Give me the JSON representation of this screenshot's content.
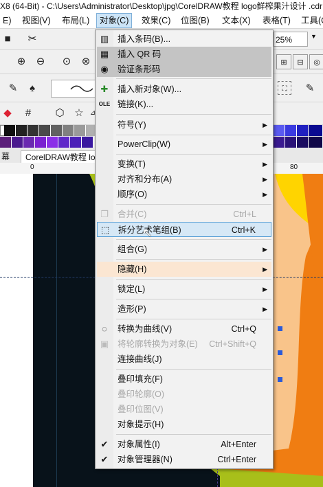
{
  "titlebar": {
    "text": "X8 (64-Bit) - C:\\Users\\Administrator\\Desktop\\jpg\\CorelDRAW教程 logo鲜榨果汁设计 .cdr"
  },
  "menubar": [
    {
      "label": "E)"
    },
    {
      "label": "视图(V)"
    },
    {
      "label": "布局(L)"
    },
    {
      "label": "对象(C)"
    },
    {
      "label": "效果(C)"
    },
    {
      "label": "位图(B)"
    },
    {
      "label": "文本(X)"
    },
    {
      "label": "表格(T)"
    },
    {
      "label": "工具(O"
    }
  ],
  "toolbar": {
    "zoom_value": "25%"
  },
  "tabs": {
    "left_tab": "幕",
    "doc_tab": "CorelDRAW教程 log"
  },
  "ruler": {
    "mark_0": "0",
    "mark_80": "80"
  },
  "menu": {
    "items": [
      {
        "label": "插入条码(B)...",
        "icon": "barcode-icon"
      },
      {
        "label": "插入 QR 码",
        "icon": "qr-code-icon"
      },
      {
        "label": "验证条形码",
        "icon": "verify-barcode-icon"
      },
      {
        "label": "插入新对象(W)...",
        "icon": "insert-object-icon"
      },
      {
        "label": "链接(K)...",
        "icon": "ole-icon"
      },
      {
        "label": "符号(Y)"
      },
      {
        "label": "PowerClip(W)"
      },
      {
        "label": "变换(T)"
      },
      {
        "label": "对齐和分布(A)"
      },
      {
        "label": "顺序(O)"
      },
      {
        "label": "合并(C)",
        "shortcut": "Ctrl+L",
        "icon": "combine-icon"
      },
      {
        "label": "拆分艺术笔组(B)",
        "shortcut": "Ctrl+K",
        "icon": "break-apart-icon"
      },
      {
        "label": "组合(G)"
      },
      {
        "label": "隐藏(H)"
      },
      {
        "label": "锁定(L)"
      },
      {
        "label": "造形(P)"
      },
      {
        "label": "转换为曲线(V)",
        "shortcut": "Ctrl+Q",
        "icon": "convert-curves-icon"
      },
      {
        "label": "将轮廓转换为对象(E)",
        "shortcut": "Ctrl+Shift+Q",
        "icon": "outline-to-object-icon"
      },
      {
        "label": "连接曲线(J)"
      },
      {
        "label": "叠印填充(F)"
      },
      {
        "label": "叠印轮廓(O)"
      },
      {
        "label": "叠印位图(V)"
      },
      {
        "label": "对象提示(H)"
      },
      {
        "label": "对象属性(I)",
        "shortcut": "Alt+Enter",
        "icon": "checkmark-icon"
      },
      {
        "label": "对象管理器(N)",
        "shortcut": "Ctrl+Enter",
        "icon": "checkmark-icon"
      }
    ]
  },
  "colors": {
    "canvas_dark": "#08121a",
    "orange": "#f07d12",
    "lime": "#a8bf1a",
    "highlight": "#d6e8f6"
  }
}
